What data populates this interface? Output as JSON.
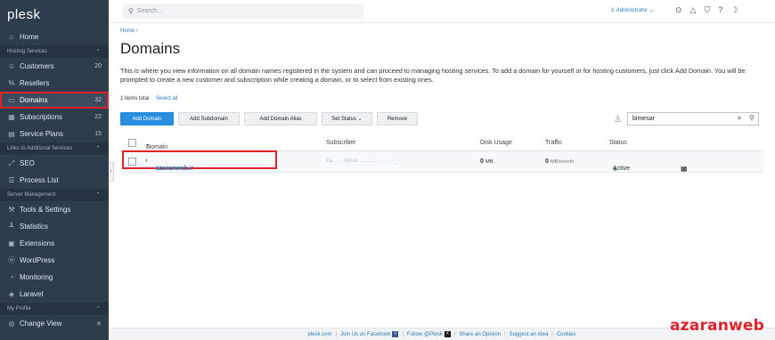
{
  "sidebar": {
    "logo": "plesk",
    "home": "Home",
    "section_hosting": "Hosting Services",
    "customers": {
      "label": "Customers",
      "count": "20"
    },
    "resellers": "Resellers",
    "domains": {
      "label": "Domains",
      "count": "32"
    },
    "subscriptions": {
      "label": "Subscriptions",
      "count": "22"
    },
    "service_plans": {
      "label": "Service Plans",
      "count": "15"
    },
    "section_links": "Links to Additional Services",
    "seo": "SEO",
    "process_list": "Process List",
    "section_server": "Server Management",
    "tools_settings": "Tools & Settings",
    "statistics": "Statistics",
    "extensions": "Extensions",
    "wordpress": "WordPress",
    "monitoring": "Monitoring",
    "laravel": "Laravel",
    "section_profile": "My Profile",
    "change_view": "Change View"
  },
  "topbar": {
    "search_placeholder": "Search...",
    "user": "Administrator"
  },
  "main": {
    "breadcrumb": "Home",
    "title": "Domains",
    "description": "This is where you view information on all domain names registered in the system and can proceed to managing hosting services. To add a domain for yourself or for hosting customers, just click Add Domain. You will be prompted to create a new customer and subscription while creating a domain, or to select from existing ones.",
    "items_total": "1 items total",
    "select_all": "Select all",
    "toolbar": {
      "add_domain": "Add Domain",
      "add_subdomain": "Add Subdomain",
      "add_domain_alias": "Add Domain Alias",
      "set_status": "Set Status",
      "remove": "Remove"
    },
    "filter_value": "bimesar",
    "columns": {
      "domain_name": "Domain Name",
      "subscriber": "Subscriber",
      "disk_usage": "Disk Usage",
      "traffic": "Traffic",
      "status": "Status"
    },
    "rows": [
      {
        "domain_prefix": "bi...e...s..r.",
        "domain_suffix": "azaranweb.ir",
        "subscriber": "xa... ..basa.............. .. -_",
        "disk_usage": "0",
        "disk_unit": "MB",
        "traffic": "0",
        "traffic_unit": "MB/month",
        "status": "Active"
      }
    ]
  },
  "footer": {
    "plesk_com": "plesk.com",
    "facebook": "Join Us on Facebook",
    "follow": "Follow @Plesk",
    "opinion": "Share an Opinion",
    "idea": "Suggest an Idea",
    "cookies": "Cookies"
  },
  "watermark": "azaranweb",
  "colors": {
    "sidebar_bg": "#2e3d4c",
    "accent": "#2a8ee0",
    "highlight": "#e0232b",
    "active_status": "#3aa35b"
  }
}
